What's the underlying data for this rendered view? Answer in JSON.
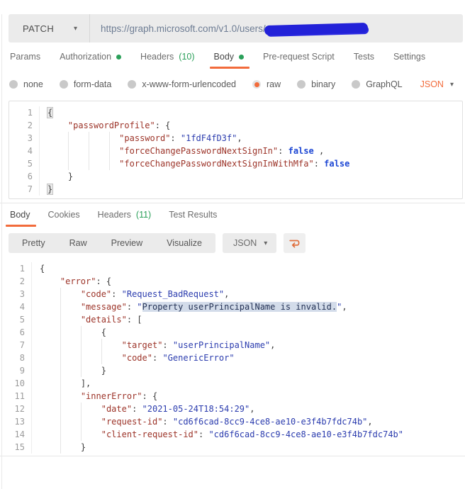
{
  "colors": {
    "accent_orange": "#f26b3b",
    "status_green": "#2ba05a",
    "redaction_blue": "#2221d8",
    "code_key": "#9c3328",
    "code_string": "#2b3cae",
    "code_boolean": "#1d47d4",
    "selection_bg": "#d3dcea"
  },
  "request": {
    "method": "PATCH",
    "url": "https://graph.microsoft.com/v1.0/users/",
    "url_redacted": true
  },
  "request_tabs": {
    "items": [
      {
        "label": "Params"
      },
      {
        "label": "Authorization",
        "dot": true
      },
      {
        "label": "Headers",
        "count": "(10)"
      },
      {
        "label": "Body",
        "dot": true,
        "active": true
      },
      {
        "label": "Pre-request Script"
      },
      {
        "label": "Tests"
      },
      {
        "label": "Settings"
      }
    ]
  },
  "body_type_options": {
    "items": [
      {
        "label": "none"
      },
      {
        "label": "form-data"
      },
      {
        "label": "x-www-form-urlencoded"
      },
      {
        "label": "raw",
        "selected": true
      },
      {
        "label": "binary"
      },
      {
        "label": "GraphQL"
      }
    ],
    "language": "JSON"
  },
  "request_editor": {
    "lines": [
      {
        "n": 1,
        "ind": 0,
        "tok": [
          [
            "box",
            "{"
          ]
        ]
      },
      {
        "n": 2,
        "ind": 1,
        "tok": [
          [
            "k",
            "\"passwordProfile\""
          ],
          [
            "p",
            ": {"
          ]
        ]
      },
      {
        "n": 3,
        "ind": 3,
        "pad": 2,
        "tok": [
          [
            "k",
            "\"password\""
          ],
          [
            "p",
            ": "
          ],
          [
            "s",
            "\"1fdF4fD3f\""
          ],
          [
            "p",
            ","
          ]
        ]
      },
      {
        "n": 4,
        "ind": 3,
        "pad": 2,
        "tok": [
          [
            "k",
            "\"forceChangePasswordNextSignIn\""
          ],
          [
            "p",
            ": "
          ],
          [
            "b",
            "false"
          ],
          [
            "p",
            " ,"
          ]
        ]
      },
      {
        "n": 5,
        "ind": 3,
        "pad": 2,
        "tok": [
          [
            "k",
            "\"forceChangePasswordNextSignInWithMfa\""
          ],
          [
            "p",
            ": "
          ],
          [
            "b",
            "false"
          ]
        ]
      },
      {
        "n": 6,
        "ind": 1,
        "tok": [
          [
            "p",
            "}"
          ]
        ]
      },
      {
        "n": 7,
        "ind": 0,
        "tok": [
          [
            "box",
            "}"
          ]
        ]
      }
    ]
  },
  "response_tabs": {
    "items": [
      {
        "label": "Body",
        "active": true
      },
      {
        "label": "Cookies"
      },
      {
        "label": "Headers",
        "count": "(11)"
      },
      {
        "label": "Test Results"
      }
    ]
  },
  "response_toolbar": {
    "views": [
      {
        "label": "Pretty",
        "active": true
      },
      {
        "label": "Raw"
      },
      {
        "label": "Preview"
      },
      {
        "label": "Visualize"
      }
    ],
    "language": "JSON",
    "wrap_icon": "wrap-lines"
  },
  "response_editor": {
    "lines": [
      {
        "n": 1,
        "ind": 0,
        "tok": [
          [
            "p",
            "{"
          ]
        ]
      },
      {
        "n": 2,
        "ind": 1,
        "tok": [
          [
            "k",
            "\"error\""
          ],
          [
            "p",
            ": {"
          ]
        ]
      },
      {
        "n": 3,
        "ind": 2,
        "tok": [
          [
            "k",
            "\"code\""
          ],
          [
            "p",
            ": "
          ],
          [
            "s",
            "\"Request_BadRequest\""
          ],
          [
            "p",
            ","
          ]
        ]
      },
      {
        "n": 4,
        "ind": 2,
        "tok": [
          [
            "k",
            "\"message\""
          ],
          [
            "p",
            ": "
          ],
          [
            "s",
            "\""
          ],
          [
            "hl",
            "Property userPrincipalName is invalid."
          ],
          [
            "s",
            "\""
          ],
          [
            "p",
            ","
          ]
        ]
      },
      {
        "n": 5,
        "ind": 2,
        "tok": [
          [
            "k",
            "\"details\""
          ],
          [
            "p",
            ": ["
          ]
        ]
      },
      {
        "n": 6,
        "ind": 3,
        "tok": [
          [
            "p",
            "{"
          ]
        ]
      },
      {
        "n": 7,
        "ind": 4,
        "tok": [
          [
            "k",
            "\"target\""
          ],
          [
            "p",
            ": "
          ],
          [
            "s",
            "\"userPrincipalName\""
          ],
          [
            "p",
            ","
          ]
        ]
      },
      {
        "n": 8,
        "ind": 4,
        "tok": [
          [
            "k",
            "\"code\""
          ],
          [
            "p",
            ": "
          ],
          [
            "s",
            "\"GenericError\""
          ]
        ]
      },
      {
        "n": 9,
        "ind": 3,
        "tok": [
          [
            "p",
            "}"
          ]
        ]
      },
      {
        "n": 10,
        "ind": 2,
        "tok": [
          [
            "p",
            "],"
          ]
        ]
      },
      {
        "n": 11,
        "ind": 2,
        "tok": [
          [
            "k",
            "\"innerError\""
          ],
          [
            "p",
            ": {"
          ]
        ]
      },
      {
        "n": 12,
        "ind": 3,
        "tok": [
          [
            "k",
            "\"date\""
          ],
          [
            "p",
            ": "
          ],
          [
            "s",
            "\"2021-05-24T18:54:29\""
          ],
          [
            "p",
            ","
          ]
        ]
      },
      {
        "n": 13,
        "ind": 3,
        "tok": [
          [
            "k",
            "\"request-id\""
          ],
          [
            "p",
            ": "
          ],
          [
            "s",
            "\"cd6f6cad-8cc9-4ce8-ae10-e3f4b7fdc74b\""
          ],
          [
            "p",
            ","
          ]
        ]
      },
      {
        "n": 14,
        "ind": 3,
        "tok": [
          [
            "k",
            "\"client-request-id\""
          ],
          [
            "p",
            ": "
          ],
          [
            "s",
            "\"cd6f6cad-8cc9-4ce8-ae10-e3f4b7fdc74b\""
          ]
        ]
      },
      {
        "n": 15,
        "ind": 2,
        "tok": [
          [
            "p",
            "}"
          ]
        ]
      }
    ]
  }
}
